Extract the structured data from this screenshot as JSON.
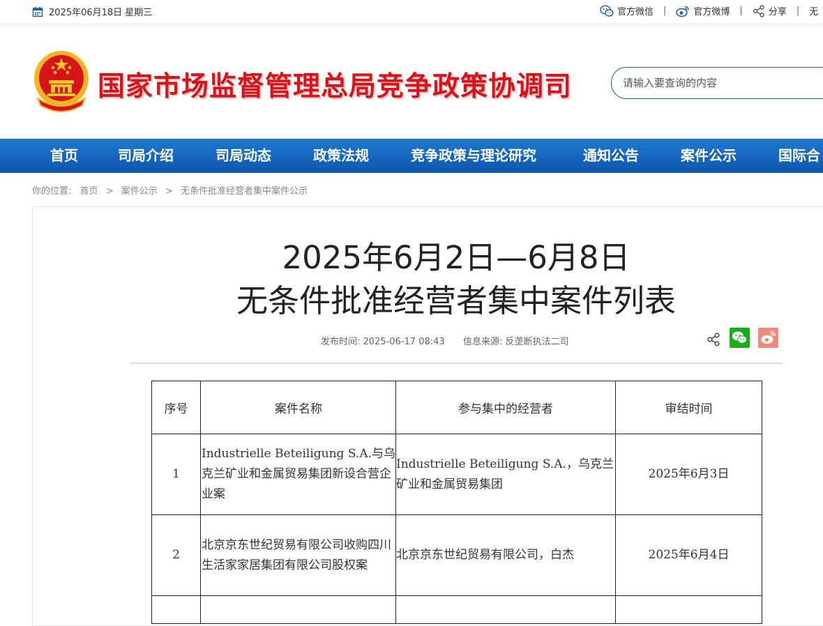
{
  "topbar": {
    "date": "2025年06月18日 星期三",
    "links": [
      "官方微信",
      "官方微博",
      "分享"
    ],
    "separator": "|",
    "overflow_char": "无"
  },
  "header": {
    "site_title": "国家市场监督管理总局竞争政策协调司",
    "search_placeholder": "请输入要查询的内容"
  },
  "nav": {
    "items": [
      "首页",
      "司局介绍",
      "司局动态",
      "政策法规",
      "竞争政策与理论研究",
      "通知公告",
      "案件公示",
      "国际合"
    ]
  },
  "breadcrumb": {
    "prefix": "你的位置:",
    "items": [
      "首页",
      "案件公示",
      "无条件批准经营者集中案件公示"
    ],
    "separator": ">"
  },
  "article": {
    "title_line1": "2025年6月2日—6月8日",
    "title_line2": "无条件批准经营者集中案件列表",
    "publish_label": "发布时间:",
    "publish_time": "2025-06-17 08:43",
    "source_label": "信息来源:",
    "source": "反垄断执法二司"
  },
  "table": {
    "headers": [
      "序号",
      "案件名称",
      "参与集中的经营者",
      "审结时间"
    ],
    "rows": [
      {
        "no": "1",
        "name": "Industrielle Beteiligung S.A.与乌克兰矿业和金属贸易集团新设合营企业案",
        "parties": "Industrielle Beteiligung S.A.，乌克兰矿业和金属贸易集团",
        "date": "2025年6月3日"
      },
      {
        "no": "2",
        "name": "北京京东世纪贸易有限公司收购四川生活家家居集团有限公司股权案",
        "parties": "北京京东世纪贸易有限公司，白杰",
        "date": "2025年6月4日"
      }
    ]
  },
  "colors": {
    "nav_top": "#1f78d0",
    "nav_bottom": "#0d57ad",
    "title_red": "#d7141a",
    "wechat_green": "#1aad19",
    "weibo_red": "#f08a7d"
  }
}
